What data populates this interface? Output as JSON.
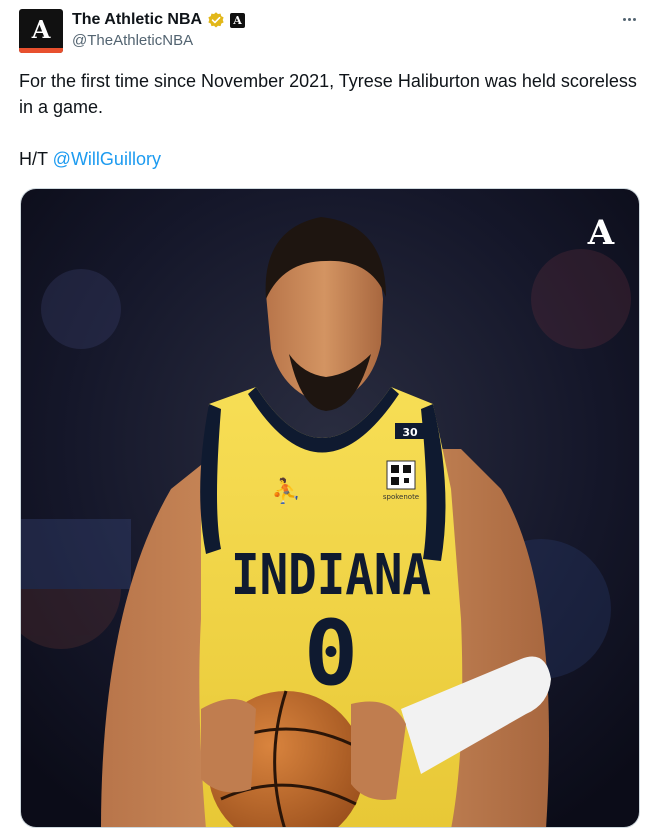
{
  "author": {
    "display_name": "The Athletic NBA",
    "handle": "@TheAthleticNBA",
    "avatar_letter": "A",
    "affiliate_letter": "A",
    "verified": true
  },
  "tweet": {
    "text_line1": "For the first time since November 2021, Tyrese Haliburton was held scoreless in a game.",
    "ht_prefix": "H/T ",
    "mention": "@WillGuillory"
  },
  "media": {
    "watermark": "A",
    "jersey_text": "INDIANA",
    "jersey_number": "0",
    "patch_number": "30",
    "sponsor_text": "spokenote"
  },
  "colors": {
    "verified_gold": "#e2b719",
    "link_blue": "#1d9bf0",
    "jersey_yellow": "#f5d94a",
    "jersey_navy": "#0f1a30",
    "brand_orange": "#e8502e"
  },
  "icons": {
    "verified": "verified-badge-icon",
    "affiliate": "affiliate-badge-icon",
    "more": "more-options-icon"
  }
}
